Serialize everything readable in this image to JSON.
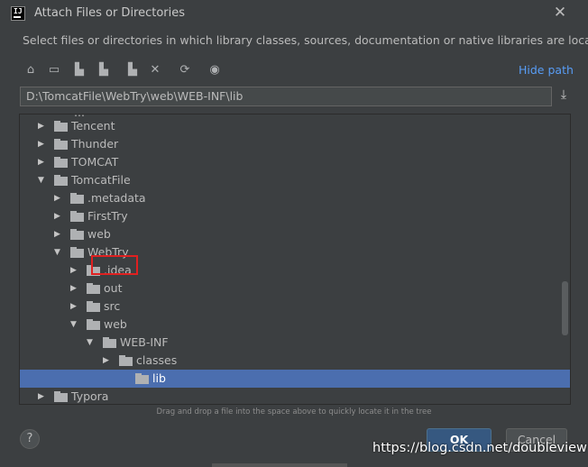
{
  "window": {
    "title": "Attach Files or Directories",
    "close_glyph": "✕"
  },
  "description": "Select files or directories in which library classes, sources, documentation or native libraries are located",
  "toolbar": {
    "icons": [
      "home-icon",
      "desktop-icon",
      "project-icon",
      "module-icon",
      "new-folder-icon",
      "delete-icon",
      "refresh-icon",
      "show-hidden-icon"
    ],
    "glyphs": [
      "⌂",
      "▭",
      "▙",
      "▙",
      "▙",
      "✕",
      "⟳",
      "◉"
    ],
    "hide_path": "Hide path"
  },
  "path": {
    "value": "D:\\TomcatFile\\WebTry\\web\\WEB-INF\\lib",
    "download_glyph": "⤓"
  },
  "tree": {
    "cut_label": "…",
    "rows": [
      {
        "label": "Tencent",
        "expanded": false,
        "selected": false
      },
      {
        "label": "Thunder",
        "expanded": false,
        "selected": false
      },
      {
        "label": "TOMCAT",
        "expanded": false,
        "selected": false
      },
      {
        "label": "TomcatFile",
        "expanded": true,
        "selected": false
      },
      {
        "label": ".metadata",
        "expanded": false,
        "selected": false
      },
      {
        "label": "FirstTry",
        "expanded": false,
        "selected": false
      },
      {
        "label": "web",
        "expanded": false,
        "selected": false
      },
      {
        "label": "WebTry",
        "expanded": true,
        "selected": false
      },
      {
        "label": ".idea",
        "expanded": false,
        "selected": false
      },
      {
        "label": "out",
        "expanded": false,
        "selected": false
      },
      {
        "label": "src",
        "expanded": false,
        "selected": false
      },
      {
        "label": "web",
        "expanded": true,
        "selected": false
      },
      {
        "label": "WEB-INF",
        "expanded": true,
        "selected": false
      },
      {
        "label": "classes",
        "expanded": false,
        "selected": false
      },
      {
        "label": "lib",
        "expanded": null,
        "selected": true
      },
      {
        "label": "Typora",
        "expanded": false,
        "selected": false
      }
    ]
  },
  "hint": "Drag and drop a file into the space above to quickly locate it in the tree",
  "buttons": {
    "help": "?",
    "ok": "OK",
    "cancel": "Cancel"
  },
  "watermark": "https://blog.csdn.net/doubleview",
  "colors": {
    "accent": "#589df6",
    "selection": "#4b6eaf",
    "highlight_box": "#e02020"
  }
}
